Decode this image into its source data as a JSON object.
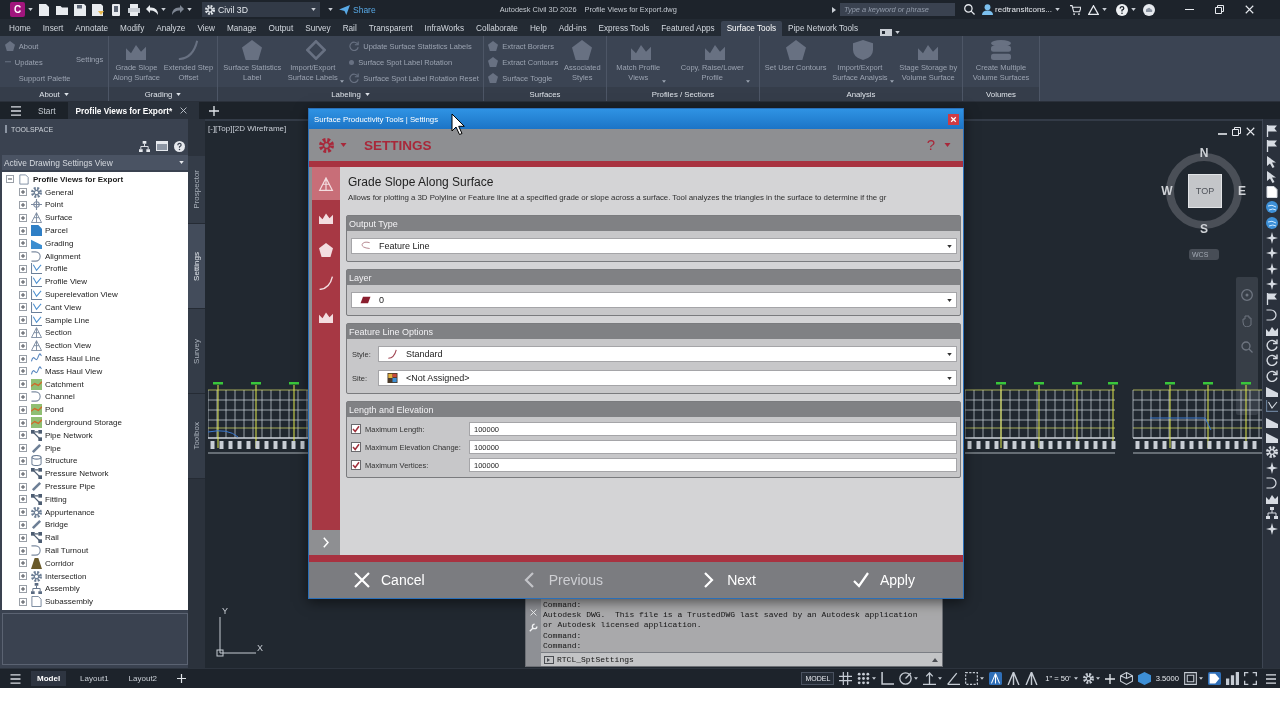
{
  "title_bar": {
    "app_letter": "C",
    "workspace": "Civil 3D",
    "share": "Share",
    "app_title": "Autodesk Civil 3D 2026",
    "file_name": "Profile Views for Export.dwg",
    "search": {
      "placeholder": "Type a keyword or phrase"
    },
    "user": "redtransitcons..."
  },
  "ribbon_tabs": [
    {
      "label": "Home",
      "selected": false
    },
    {
      "label": "Insert",
      "selected": false
    },
    {
      "label": "Annotate",
      "selected": false
    },
    {
      "label": "Modify",
      "selected": false
    },
    {
      "label": "Analyze",
      "selected": false
    },
    {
      "label": "View",
      "selected": false
    },
    {
      "label": "Manage",
      "selected": false
    },
    {
      "label": "Output",
      "selected": false
    },
    {
      "label": "Survey",
      "selected": false
    },
    {
      "label": "Rail",
      "selected": false
    },
    {
      "label": "Transparent",
      "selected": false
    },
    {
      "label": "InfraWorks",
      "selected": false
    },
    {
      "label": "Collaborate",
      "selected": false
    },
    {
      "label": "Help",
      "selected": false
    },
    {
      "label": "Add-ins",
      "selected": false
    },
    {
      "label": "Express Tools",
      "selected": false
    },
    {
      "label": "Featured Apps",
      "selected": false
    },
    {
      "label": "Surface Tools",
      "selected": true
    },
    {
      "label": "Pipe Network Tools",
      "selected": false
    }
  ],
  "ribbon_panels": [
    {
      "title": "About",
      "dropdown": true,
      "items": [
        {
          "kind": "stack",
          "items": [
            {
              "kind": "small",
              "label": "About",
              "disabled": true
            },
            {
              "kind": "small",
              "label": "Updates",
              "disabled": true
            },
            {
              "kind": "text",
              "label": "Support Palette",
              "disabled": true
            }
          ]
        },
        {
          "kind": "text",
          "label": "Settings",
          "disabled": true
        }
      ]
    },
    {
      "title": "Grading",
      "dropdown": true,
      "items": [
        {
          "kind": "large",
          "label": "Grade Slope\nAlong Surface",
          "dropdown": false,
          "disabled": true
        },
        {
          "kind": "large",
          "label": "Extended Step\nOffset",
          "dropdown": false,
          "disabled": true
        }
      ]
    },
    {
      "title": "Labeling",
      "dropdown": true,
      "items": [
        {
          "kind": "large",
          "label": "Surface Statistics\nLabel",
          "dropdown": false,
          "disabled": true
        },
        {
          "kind": "large",
          "label": "Import/Export\nSurface Labels",
          "dropdown": true,
          "disabled": true
        },
        {
          "kind": "stack",
          "items": [
            {
              "kind": "small",
              "label": "Update Surface Statistics Labels",
              "disabled": true
            },
            {
              "kind": "small",
              "label": "Surface Spot Label Rotation",
              "disabled": true
            },
            {
              "kind": "small",
              "label": "Surface Spot Label Rotation Reset",
              "disabled": true
            }
          ]
        }
      ]
    },
    {
      "title": "Surfaces",
      "dropdown": false,
      "items": [
        {
          "kind": "stack",
          "items": [
            {
              "kind": "small",
              "label": "Extract Borders",
              "disabled": true
            },
            {
              "kind": "small",
              "label": "Extract Contours",
              "disabled": true
            },
            {
              "kind": "small",
              "label": "Surface Toggle",
              "disabled": true
            }
          ]
        },
        {
          "kind": "large",
          "label": "Associated\nStyles",
          "dropdown": false,
          "disabled": true
        }
      ]
    },
    {
      "title": "Profiles / Sections",
      "dropdown": false,
      "items": [
        {
          "kind": "large",
          "label": "Match Profile\nViews",
          "dropdown": true,
          "disabled": true
        },
        {
          "kind": "large",
          "label": "Copy, Raise/Lower\nProfile",
          "dropdown": true,
          "disabled": true
        }
      ]
    },
    {
      "title": "Analysis",
      "dropdown": false,
      "items": [
        {
          "kind": "large",
          "label": "Set User Contours",
          "dropdown": false,
          "disabled": true
        },
        {
          "kind": "large",
          "label": "Import/Export\nSurface Analysis",
          "dropdown": true,
          "disabled": true
        },
        {
          "kind": "large",
          "label": "Stage Storage by\nVolume Surface",
          "dropdown": false,
          "disabled": true
        }
      ]
    },
    {
      "title": "Volumes",
      "dropdown": false,
      "items": [
        {
          "kind": "large",
          "label": "Create Multiple\nVolume Surfaces",
          "dropdown": false,
          "disabled": true
        }
      ]
    }
  ],
  "doc_tabs": [
    {
      "label": "Start",
      "selected": false
    },
    {
      "label": "Profile Views for Export*",
      "selected": true
    }
  ],
  "toolspace": {
    "title": "TOOLSPACE",
    "view": "Active Drawing Settings View",
    "tree": {
      "label": "Profile Views for Export",
      "expanded": true,
      "children": [
        {
          "label": "General",
          "expanded": false
        },
        {
          "label": "Point",
          "expanded": false
        },
        {
          "label": "Surface",
          "expanded": false
        },
        {
          "label": "Parcel",
          "expanded": false
        },
        {
          "label": "Grading",
          "expanded": false
        },
        {
          "label": "Alignment",
          "expanded": false
        },
        {
          "label": "Profile",
          "expanded": false
        },
        {
          "label": "Profile View",
          "expanded": false
        },
        {
          "label": "Superelevation View",
          "expanded": false
        },
        {
          "label": "Cant View",
          "expanded": false
        },
        {
          "label": "Sample Line",
          "expanded": false
        },
        {
          "label": "Section",
          "expanded": false
        },
        {
          "label": "Section View",
          "expanded": false
        },
        {
          "label": "Mass Haul Line",
          "expanded": false
        },
        {
          "label": "Mass Haul View",
          "expanded": false
        },
        {
          "label": "Catchment",
          "expanded": false
        },
        {
          "label": "Channel",
          "expanded": false
        },
        {
          "label": "Pond",
          "expanded": false
        },
        {
          "label": "Underground Storage",
          "expanded": false
        },
        {
          "label": "Pipe Network",
          "expanded": false
        },
        {
          "label": "Pipe",
          "expanded": false
        },
        {
          "label": "Structure",
          "expanded": false
        },
        {
          "label": "Pressure Network",
          "expanded": false
        },
        {
          "label": "Pressure Pipe",
          "expanded": false
        },
        {
          "label": "Fitting",
          "expanded": false
        },
        {
          "label": "Appurtenance",
          "expanded": false
        },
        {
          "label": "Bridge",
          "expanded": false
        },
        {
          "label": "Rail",
          "expanded": false
        },
        {
          "label": "Rail Turnout",
          "expanded": false
        },
        {
          "label": "Corridor",
          "expanded": false
        },
        {
          "label": "Intersection",
          "expanded": false
        },
        {
          "label": "Assembly",
          "expanded": false
        },
        {
          "label": "Subassembly",
          "expanded": false
        }
      ]
    },
    "side_tabs": [
      {
        "label": "Prospector",
        "selected": false
      },
      {
        "label": "Settings",
        "selected": true
      },
      {
        "label": "Survey",
        "selected": false
      },
      {
        "label": "Toolbox",
        "selected": false
      }
    ]
  },
  "viewport": {
    "label": "[-][Top][2D Wireframe]",
    "viewcube": {
      "north": "N",
      "west": "W",
      "face": "TOP",
      "east": "E",
      "south": "S",
      "ucs": "WCS"
    },
    "ucs_icon": {
      "y_label": "Y",
      "x_label": "X"
    }
  },
  "command_line": {
    "history": [
      "Command:",
      "Autodesk DWG.  This file is a TrustedDWG last saved by an Autodesk application",
      "or Autodesk licensed application.",
      "Command:",
      "Command:"
    ],
    "input": "RTCL_SptSettings"
  },
  "dialog": {
    "title": "Surface Productivity Tools | Settings",
    "header": "SETTINGS",
    "help": "?",
    "sidebar_tools": [
      {
        "selected": true
      },
      {
        "selected": false
      },
      {
        "selected": false
      },
      {
        "selected": false
      },
      {
        "selected": false
      }
    ],
    "heading": "Grade Slope Along Surface",
    "description": "Allows for plotting a 3D Polyline or Feature line at a specified grade or slope across a surface. Tool analyzes the triangles in the surface to determine if the gr",
    "groups": [
      {
        "title": "Output Type",
        "fields": [
          {
            "kind": "dropdown",
            "value": "Feature Line"
          }
        ]
      },
      {
        "title": "Layer",
        "fields": [
          {
            "kind": "dropdown",
            "value": "0"
          }
        ]
      },
      {
        "title": "Feature Line Options",
        "fields": [
          {
            "kind": "dropdown",
            "label": "Style:",
            "value": "Standard"
          },
          {
            "kind": "dropdown",
            "label": "Site:",
            "value": "<Not Assigned>"
          }
        ]
      },
      {
        "title": "Length and Elevation",
        "fields": [
          {
            "kind": "checkbox",
            "label": "Maximum Length:",
            "checked": true,
            "value": "100000"
          },
          {
            "kind": "checkbox",
            "label": "Maximum Elevation Change:",
            "checked": true,
            "value": "100000"
          },
          {
            "kind": "checkbox",
            "label": "Maximum Vertices:",
            "checked": true,
            "value": "100000"
          }
        ]
      }
    ],
    "buttons": [
      {
        "kind": "cancel",
        "label": "Cancel",
        "disabled": false
      },
      {
        "kind": "previous",
        "label": "Previous",
        "disabled": true
      },
      {
        "kind": "next",
        "label": "Next",
        "disabled": false
      },
      {
        "kind": "apply",
        "label": "Apply",
        "disabled": false
      }
    ]
  },
  "status_bar": {
    "layout_tabs": [
      {
        "label": "Model",
        "selected": true
      },
      {
        "label": "Layout1",
        "selected": false
      },
      {
        "label": "Layout2",
        "selected": false
      }
    ],
    "space": "MODEL",
    "toggles": [
      {
        "on": false
      },
      {
        "on": false
      },
      {
        "on": false
      },
      {
        "on": false
      },
      {
        "on": false
      },
      {
        "on": false
      },
      {
        "on": false
      },
      {
        "on": true
      },
      {
        "on": false
      },
      {
        "on": false
      },
      {
        "on": false
      },
      {
        "on": false
      },
      {
        "on": false
      },
      {
        "on": true
      },
      {
        "on": false
      },
      {
        "on": false
      }
    ],
    "scale": "1\" = 50'",
    "value": "3.5000"
  }
}
